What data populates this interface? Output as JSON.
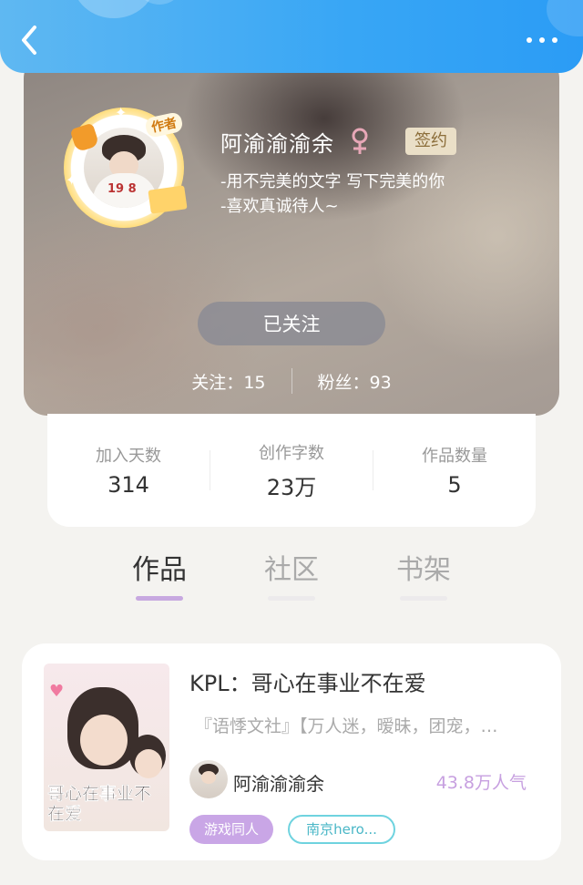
{
  "header": {
    "back_icon": "chevron-left-icon",
    "more_icon": "more-dots-icon"
  },
  "profile": {
    "author_badge": "作者",
    "name": "阿渝渝渝余",
    "gender_icon": "female-icon",
    "sign_badge": "签约",
    "bio_line1": "-用不完美的文字 写下完美的你",
    "bio_line2": "-喜欢真诚待人~",
    "follow_button": "已关注",
    "following_label": "关注：",
    "following_count": "15",
    "fans_label": "粉丝：",
    "fans_count": "93"
  },
  "stats": [
    {
      "label": "加入天数",
      "value": "314"
    },
    {
      "label": "创作字数",
      "value": "23万"
    },
    {
      "label": "作品数量",
      "value": "5"
    }
  ],
  "tabs": [
    {
      "label": "作品",
      "active": true
    },
    {
      "label": "社区",
      "active": false
    },
    {
      "label": "书架",
      "active": false
    }
  ],
  "work": {
    "cover_title": "哥心在事业不在爱",
    "title": "KPL：哥心在事业不在爱",
    "description": "『语悸文社』【万人迷，暧昧，团宠，…",
    "author": "阿渝渝渝余",
    "popularity": "43.8万人气",
    "tag_primary": "游戏同人",
    "tag_secondary": "南京hero..."
  },
  "colors": {
    "header_blue": "#38a6f5",
    "accent_purple": "#c9a6e6",
    "tag_teal": "#6fd3df",
    "sign_badge_bg": "#eadfc7"
  }
}
